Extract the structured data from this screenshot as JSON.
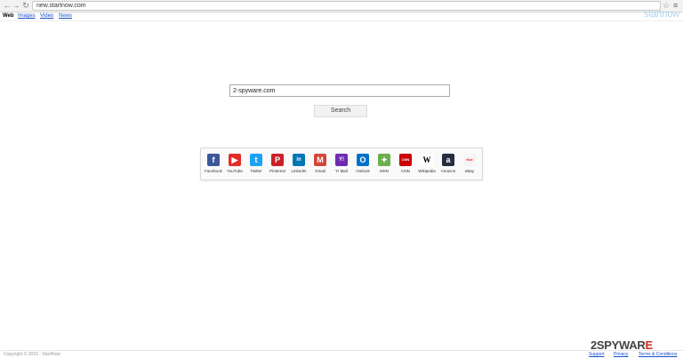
{
  "browser": {
    "url": "new.startnow.com"
  },
  "nav": {
    "tabs": [
      {
        "label": "Web"
      },
      {
        "label": "Images"
      },
      {
        "label": "Video"
      },
      {
        "label": "News"
      }
    ]
  },
  "brand": "startnow",
  "search": {
    "value": "2-spyware.com",
    "button": "Search"
  },
  "shortcuts": [
    {
      "label": "Facebook",
      "icon": "facebook-icon",
      "color": "#3b5998",
      "glyph": "f"
    },
    {
      "label": "YouTube",
      "icon": "youtube-icon",
      "color": "#e52d27",
      "glyph": "▶"
    },
    {
      "label": "Twitter",
      "icon": "twitter-icon",
      "color": "#1da1f2",
      "glyph": "t"
    },
    {
      "label": "Pinterest",
      "icon": "pinterest-icon",
      "color": "#cb2027",
      "glyph": "P"
    },
    {
      "label": "LinkedIn",
      "icon": "linkedin-icon",
      "color": "#0077b5",
      "glyph": "in"
    },
    {
      "label": "Gmail",
      "icon": "gmail-icon",
      "color": "#d44638",
      "glyph": "M"
    },
    {
      "label": "Y! Mail",
      "icon": "yahoo-mail-icon",
      "color": "#6e2bb2",
      "glyph": "Y!"
    },
    {
      "label": "Outlook",
      "icon": "outlook-icon",
      "color": "#0072c6",
      "glyph": "O"
    },
    {
      "label": "MSN",
      "icon": "msn-icon",
      "color": "#6ab04c",
      "glyph": "✦"
    },
    {
      "label": "CNN",
      "icon": "cnn-icon",
      "color": "#cc0000",
      "glyph": "CNN"
    },
    {
      "label": "Wikipedia",
      "icon": "wikipedia-icon",
      "color": "#ffffff",
      "glyph": "W"
    },
    {
      "label": "Amazon",
      "icon": "amazon-icon",
      "color": "#232f3e",
      "glyph": "a"
    },
    {
      "label": "eBay",
      "icon": "ebay-icon",
      "color": "#f5f5f5",
      "glyph": "ebay"
    }
  ],
  "footer": {
    "copyright": "Copyright © 2016 - StartNow",
    "links": [
      "Support",
      "Privacy",
      "Terms & Conditions"
    ]
  },
  "watermark": {
    "part1": "2SPYWAR",
    "part2": "E"
  }
}
